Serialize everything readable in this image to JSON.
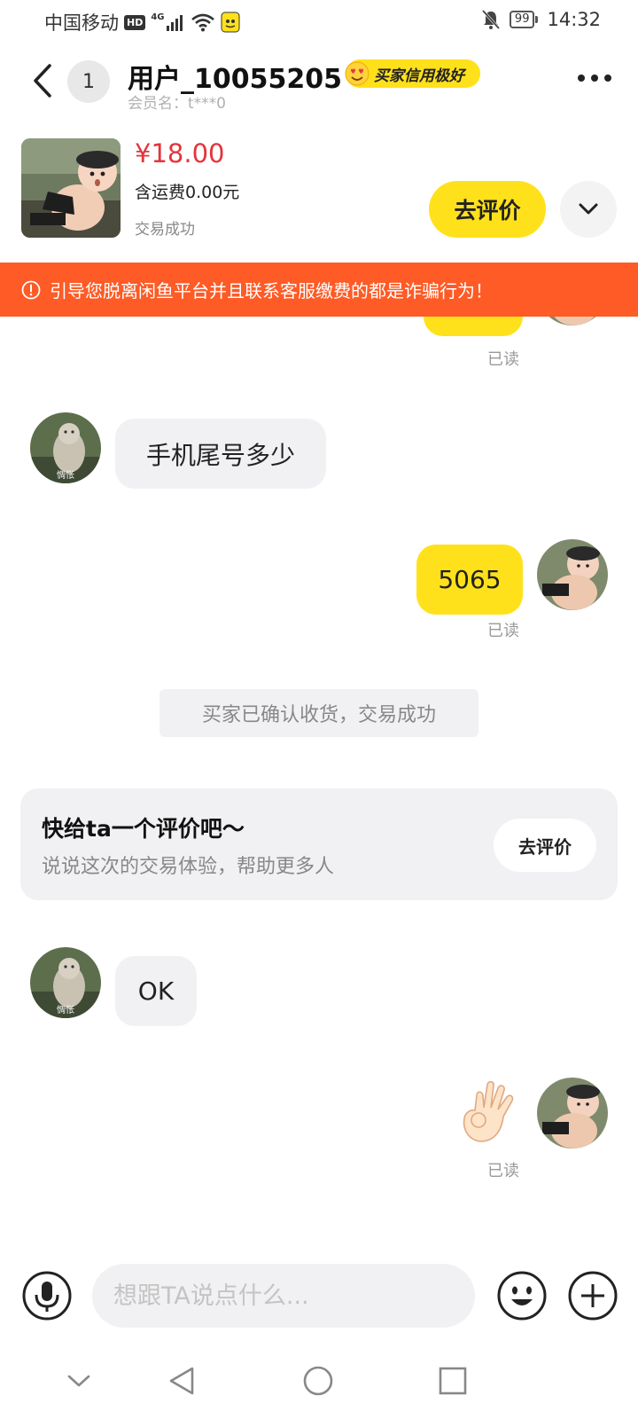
{
  "status_bar": {
    "carrier": "中国移动",
    "hd": "HD",
    "network": "4G",
    "battery": "99",
    "time": "14:32"
  },
  "header": {
    "unread_count": "1",
    "user_name": "用户_10055205",
    "credit_badge": "买家信用极好",
    "member_name": "会员名：t***0"
  },
  "product": {
    "price": "¥18.00",
    "shipping": "含运费0.00元",
    "status": "交易成功",
    "review_button": "去评价"
  },
  "warning": {
    "text": "引导您脱离闲鱼平台并且联系客服缴费的都是诈骗行为！"
  },
  "messages": {
    "read_label": "已读",
    "msg_phone_question": "手机尾号多少",
    "msg_phone_answer": "5065",
    "system_notice": "买家已确认收货，交易成功",
    "msg_ok": "OK"
  },
  "review_card": {
    "title": "快给ta一个评价吧～",
    "subtitle": "说说这次的交易体验，帮助更多人",
    "button": "去评价"
  },
  "input": {
    "placeholder": "想跟TA说点什么..."
  },
  "icons": {
    "back": "chevron-left-icon",
    "more": "more-dots-icon",
    "expand": "chevron-down-icon",
    "voice": "microphone-icon",
    "emoji": "smiley-icon",
    "add": "plus-icon",
    "ok_gesture": "ok-hand-icon"
  },
  "colors": {
    "accent_yellow": "#ffe11b",
    "warning_orange": "#fe5b26",
    "price_red": "#e5343a"
  }
}
